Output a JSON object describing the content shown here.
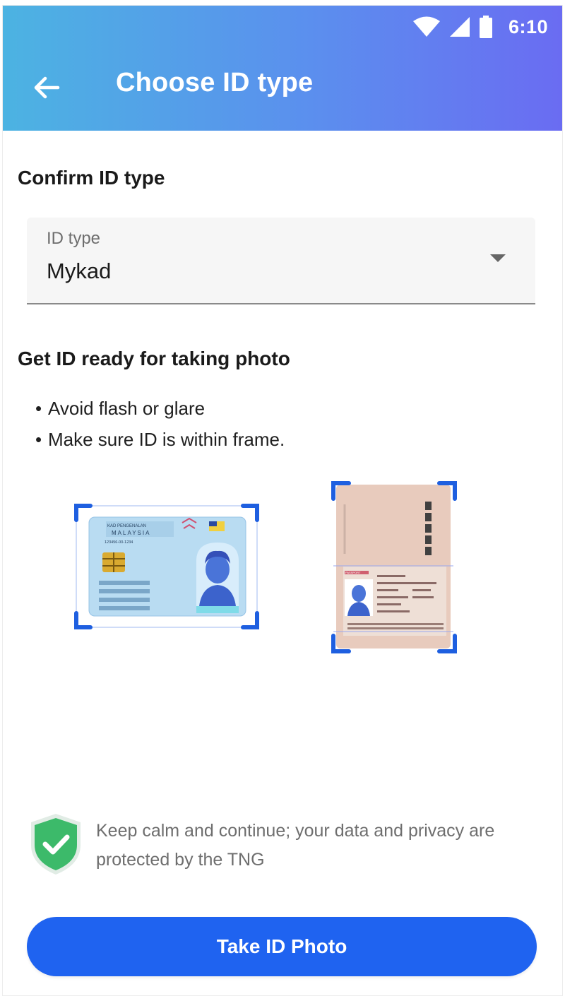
{
  "status_bar": {
    "time": "6:10"
  },
  "header": {
    "title": "Choose ID type"
  },
  "confirm": {
    "heading": "Confirm ID type",
    "field_label": "ID type",
    "field_value": "Mykad"
  },
  "ready": {
    "heading": "Get ID ready for taking photo",
    "tips": [
      "Avoid flash or glare",
      "Make sure ID is within frame."
    ]
  },
  "id_card": {
    "line1": "KAD PENGENALAN",
    "line2": "MALAYSIA",
    "number": "123456-00-1234"
  },
  "passport": {
    "label": "PASSPORT"
  },
  "privacy": {
    "text": "Keep calm and continue; your data and privacy are protected by the TNG"
  },
  "action": {
    "label": "Take ID Photo"
  },
  "colors": {
    "header_gradient_start": "#4cb3e2",
    "header_gradient_end": "#6a6cf2",
    "primary_button": "#1f63f0",
    "shield_green": "#3cba6a",
    "frame_corner": "#1e5fe0"
  },
  "icons": {
    "back": "arrow-left-icon",
    "wifi": "wifi-icon",
    "signal": "cellular-signal-icon",
    "battery": "battery-icon",
    "dropdown": "caret-down-icon",
    "shield": "shield-check-icon"
  }
}
